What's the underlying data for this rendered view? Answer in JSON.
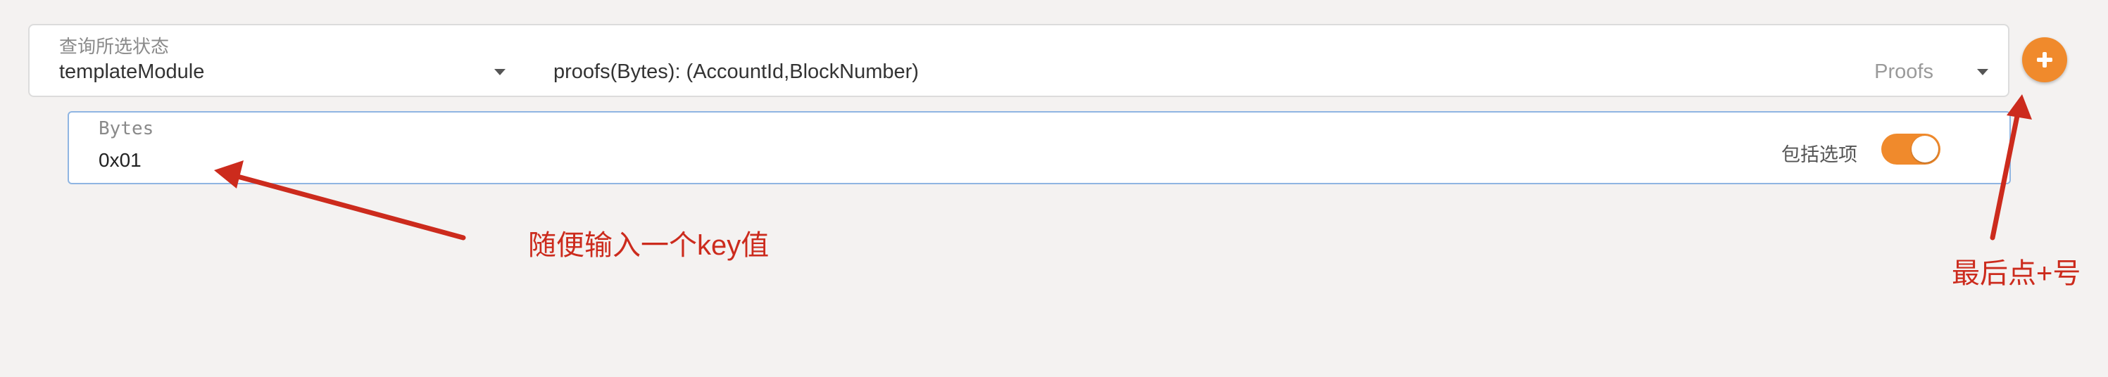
{
  "query": {
    "label": "查询所选状态",
    "module_value": "templateModule",
    "method_value": "proofs(Bytes): (AccountId,BlockNumber)",
    "method_doc": "Proofs"
  },
  "param": {
    "label": "Bytes",
    "value": "0x01",
    "option_label": "包括选项",
    "option_enabled": true
  },
  "annotations": {
    "input_hint": "随便输入一个key值",
    "final_hint": "最后点+号"
  },
  "colors": {
    "accent": "#f08a2c",
    "annotation": "#cc2b1d",
    "input_border": "#8fb5e2"
  },
  "icons": {
    "add_button": "plus-icon",
    "dropdown": "caret-down-icon"
  }
}
